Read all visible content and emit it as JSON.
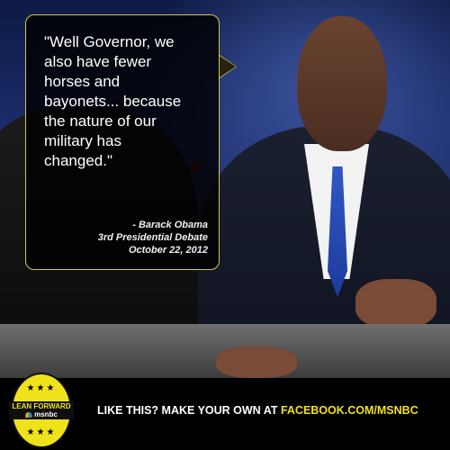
{
  "quote": {
    "lines": [
      "\"Well Governor, we",
      "also have fewer",
      "horses and",
      "bayonets... because",
      "the nature of our",
      "military has",
      "changed.\""
    ],
    "attribution": {
      "speaker": "- Barack Obama",
      "event": "3rd Presidential Debate",
      "date": "October 22, 2012"
    }
  },
  "badge": {
    "stars_top": "★★★",
    "line1": "LEAN FORWARD",
    "line2": "msnbc",
    "stars_bottom": "★★★",
    "color": "#F0E21A"
  },
  "footer": {
    "cta_prefix": "LIKE THIS? MAKE YOUR OWN AT ",
    "cta_link": "FACEBOOK.COM/MSNBC"
  }
}
